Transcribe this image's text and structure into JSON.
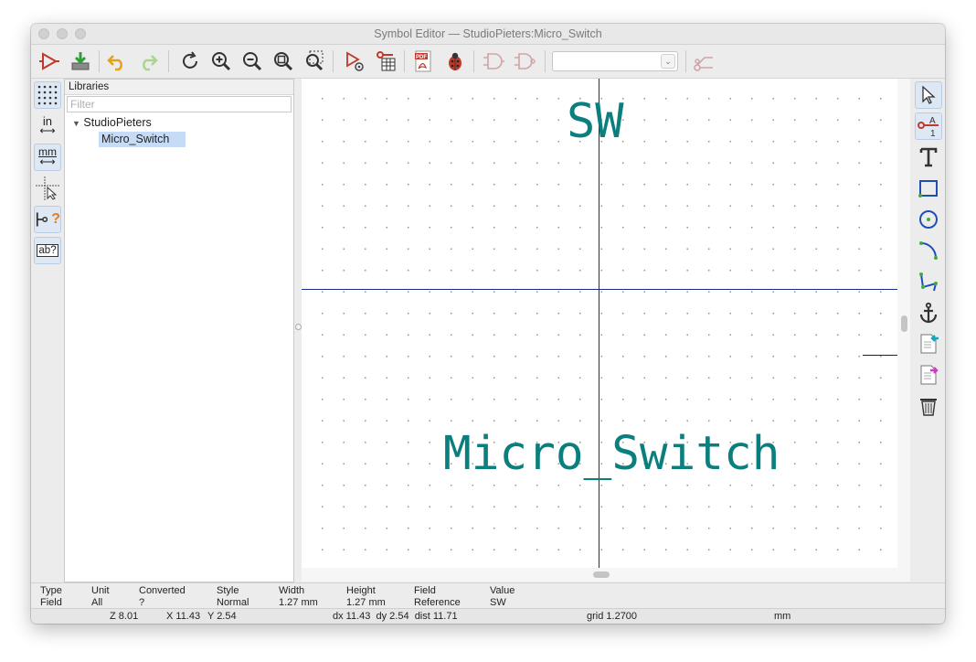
{
  "window": {
    "title": "Symbol Editor — StudioPieters:Micro_Switch"
  },
  "toolbar": {
    "buttons": [
      "new-symbol-icon",
      "save-icon",
      "undo-icon",
      "redo-icon",
      "refresh-icon",
      "zoom-in-icon",
      "zoom-out-icon",
      "zoom-fit-icon",
      "zoom-selection-icon",
      "symbol-properties-icon",
      "pin-table-icon",
      "export-pdf-icon",
      "check-symbol-icon",
      "normal-body-style-icon",
      "demorgan-body-style-icon",
      "unit-selector",
      "pin-connection-icon"
    ],
    "unit_selector_value": ""
  },
  "left_toolbar": {
    "inch_label": "in",
    "mm_label": "mm",
    "pin_mark": "?",
    "text_label": "ab?"
  },
  "libraries": {
    "header": "Libraries",
    "filter_placeholder": "Filter",
    "tree": [
      {
        "name": "StudioPieters",
        "expanded": true,
        "children": [
          {
            "name": "Micro_Switch",
            "selected": true
          }
        ]
      }
    ]
  },
  "canvas": {
    "reference_text": "SW",
    "value_text": "Micro_Switch",
    "text_color": "#0b7e7e",
    "axis_color": "#1a2a8c"
  },
  "message_panel": {
    "columns": [
      {
        "header": "Type",
        "value": "Field"
      },
      {
        "header": "Unit",
        "value": "All"
      },
      {
        "header": "Converted",
        "value": "?"
      },
      {
        "header": "Style",
        "value": "Normal"
      },
      {
        "header": "Width",
        "value": "1.27 mm"
      },
      {
        "header": "Height",
        "value": "1.27 mm"
      },
      {
        "header": "Field",
        "value": "Reference"
      },
      {
        "header": "Value",
        "value": "SW"
      }
    ]
  },
  "status": {
    "zoom": "Z 8.01",
    "x": "X 11.43",
    "y": "Y 2.54",
    "delta": "dx 11.43  dy 2.54  dist 11.71",
    "grid": "grid 1.2700",
    "units": "mm"
  },
  "colors": {
    "selection": "#c6dcf6",
    "accent_teal": "#0b7e7e",
    "toolbar_red": "#c0392b"
  }
}
